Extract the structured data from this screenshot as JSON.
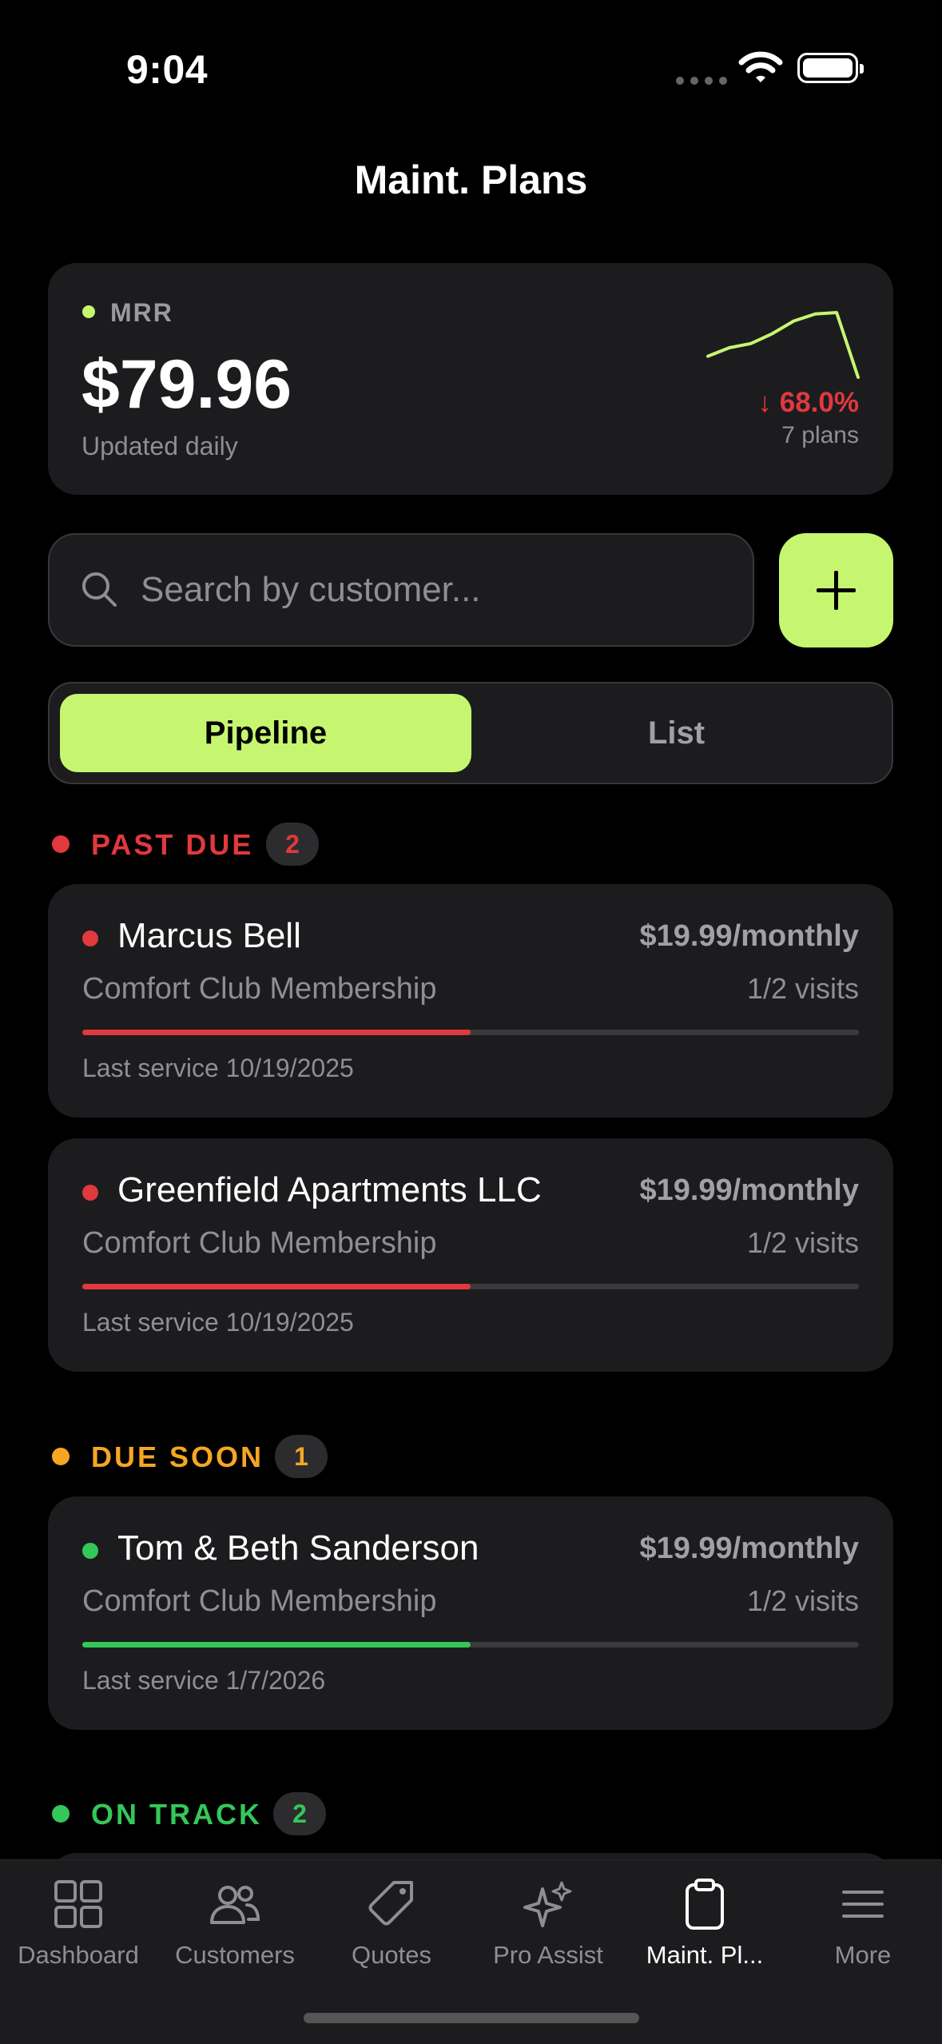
{
  "status_bar": {
    "time": "9:04"
  },
  "header": {
    "title": "Maint. Plans"
  },
  "mrr": {
    "label": "MRR",
    "value": "$79.96",
    "subtitle": "Updated daily",
    "change": "↓ 68.0%",
    "plans_count": "7 plans",
    "trend": [
      0.3,
      0.42,
      0.48,
      0.62,
      0.8,
      0.9,
      0.92,
      0.0
    ],
    "accent_color": "#c6f66f",
    "down_color": "#e0393e"
  },
  "search": {
    "placeholder": "Search by customer..."
  },
  "add_button": {
    "icon": "plus-icon"
  },
  "segment": {
    "active": "Pipeline",
    "inactive": "List"
  },
  "sections": [
    {
      "label": "PAST DUE",
      "count": "2",
      "color": "#e0393e",
      "items": [
        {
          "name": "Marcus Bell",
          "price": "$19.99/monthly",
          "plan": "Comfort Club Membership",
          "visits": "1/2 visits",
          "progress": 0.5,
          "last_service": "Last service 10/19/2025",
          "color": "#e0393e"
        },
        {
          "name": "Greenfield Apartments LLC",
          "price": "$19.99/monthly",
          "plan": "Comfort Club Membership",
          "visits": "1/2 visits",
          "progress": 0.5,
          "last_service": "Last service 10/19/2025",
          "color": "#e0393e"
        }
      ]
    },
    {
      "label": "DUE SOON",
      "count": "1",
      "color": "#f5a623",
      "items": [
        {
          "name": "Tom & Beth Sanderson",
          "price": "$19.99/monthly",
          "plan": "Comfort Club Membership",
          "visits": "1/2 visits",
          "progress": 0.5,
          "last_service": "Last service 1/7/2026",
          "color": "#34c759"
        }
      ]
    },
    {
      "label": "ON TRACK",
      "count": "2",
      "color": "#34c759",
      "items": []
    }
  ],
  "tabs": [
    {
      "label": "Dashboard",
      "icon": "grid-icon",
      "active": false
    },
    {
      "label": "Customers",
      "icon": "people-icon",
      "active": false
    },
    {
      "label": "Quotes",
      "icon": "tag-icon",
      "active": false
    },
    {
      "label": "Pro Assist",
      "icon": "sparkles-icon",
      "active": false
    },
    {
      "label": "Maint. Pl...",
      "icon": "clipboard-icon",
      "active": true
    },
    {
      "label": "More",
      "icon": "menu-icon",
      "active": false
    }
  ]
}
